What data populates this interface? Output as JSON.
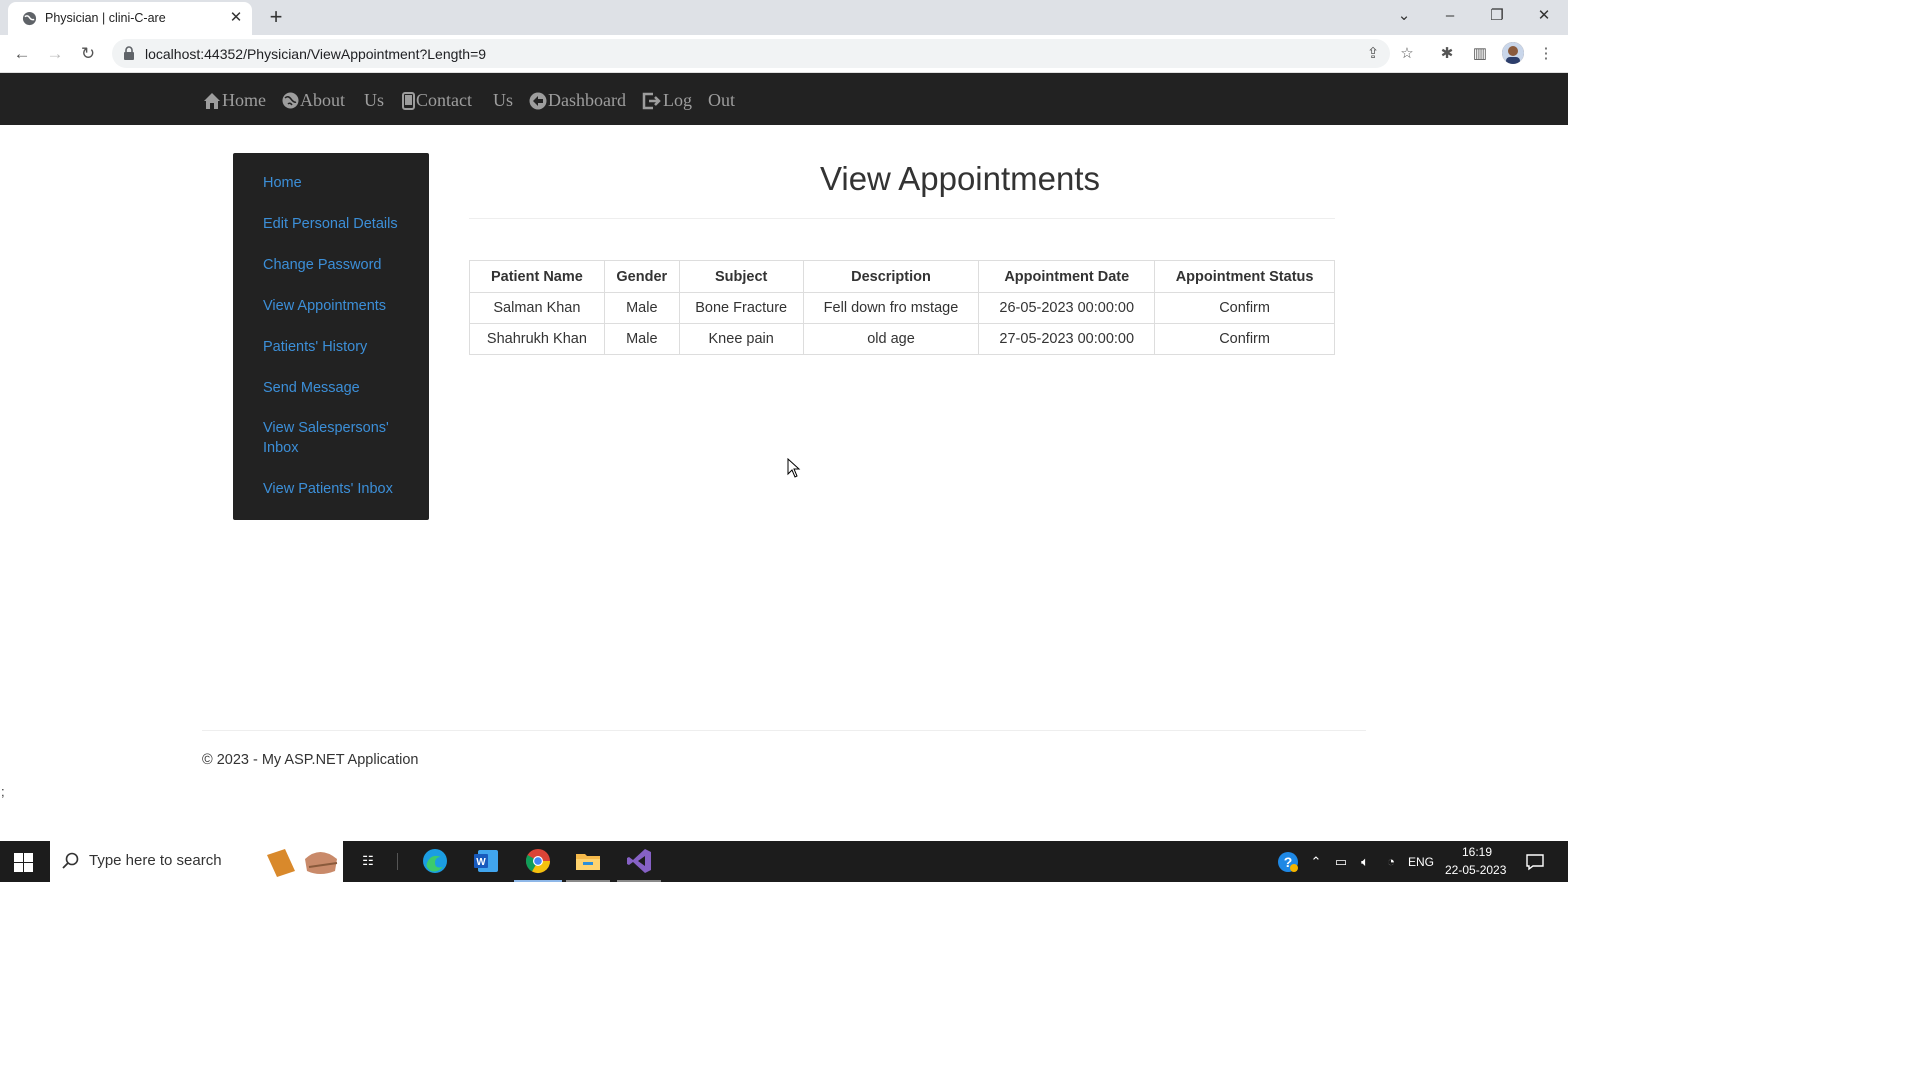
{
  "browser": {
    "tab_title": "Physician | clini-C-are",
    "url": "localhost:44352/Physician/ViewAppointment?Length=9"
  },
  "navbar": {
    "items": [
      {
        "label": "Home",
        "icon": "home-icon"
      },
      {
        "label": "About",
        "icon": "globe-icon"
      },
      {
        "label": "Us"
      },
      {
        "label": "Contact",
        "icon": "phone-icon"
      },
      {
        "label": "Us"
      },
      {
        "label": "Dashboard",
        "icon": "arrow-circle-icon"
      },
      {
        "label": "Log",
        "icon": "logout-icon"
      },
      {
        "label": "Out"
      }
    ],
    "background": "#222222",
    "link_color": "#9d9d9d"
  },
  "sidebar": {
    "items": [
      {
        "label": "Home"
      },
      {
        "label": "Edit Personal Details"
      },
      {
        "label": "Change Password"
      },
      {
        "label": "View Appointments"
      },
      {
        "label": "Patients' History"
      },
      {
        "label": "Send Message"
      },
      {
        "label": "View Salespersons' Inbox"
      },
      {
        "label": "View Patients' Inbox"
      }
    ],
    "link_color": "#3c8fd8"
  },
  "main": {
    "title": "View Appointments",
    "table": {
      "headers": [
        "Patient Name",
        "Gender",
        "Subject",
        "Description",
        "Appointment Date",
        "Appointment Status"
      ],
      "rows": [
        [
          "Salman Khan",
          "Male",
          "Bone Fracture",
          "Fell down fro mstage",
          "26-05-2023 00:00:00",
          "Confirm"
        ],
        [
          "Shahrukh Khan",
          "Male",
          "Knee pain",
          "old age",
          "27-05-2023 00:00:00",
          "Confirm"
        ]
      ]
    }
  },
  "footer": {
    "text": "© 2023 - My ASP.NET Application",
    "stray_char": ";"
  },
  "taskbar": {
    "search_placeholder": "Type here to search",
    "language": "ENG",
    "time": "16:19",
    "date": "22-05-2023"
  }
}
